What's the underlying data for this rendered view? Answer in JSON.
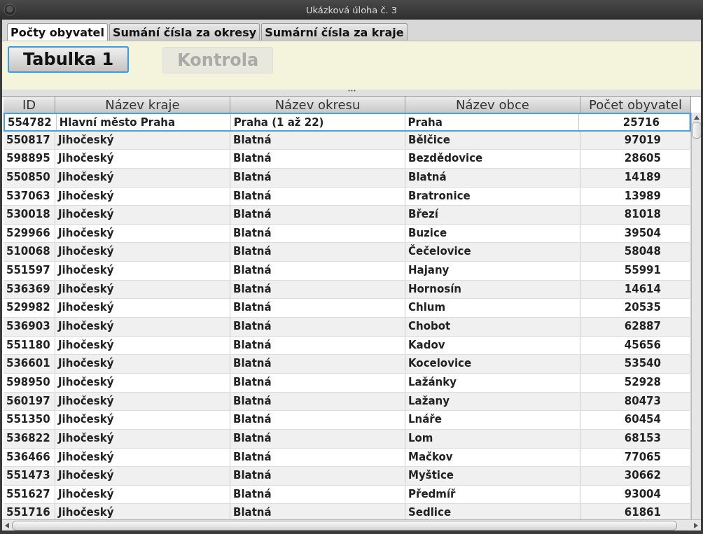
{
  "window": {
    "title": "Ukázková úloha č. 3"
  },
  "tabs": [
    {
      "label": "Počty obyvatel",
      "selected": true
    },
    {
      "label": "Sumání čísla za okresy",
      "selected": false
    },
    {
      "label": "Sumární čísla za kraje",
      "selected": false
    }
  ],
  "buttons": [
    {
      "label": "Tabulka 1",
      "disabled": false,
      "focused": true
    },
    {
      "label": "Kontrola",
      "disabled": true,
      "focused": false
    }
  ],
  "table": {
    "columns": [
      "ID",
      "Název kraje",
      "Název okresu",
      "Název obce",
      "Počet obyvatel"
    ],
    "rows": [
      {
        "cells": [
          "554782",
          "Hlavní město Praha",
          "Praha (1 až 22)",
          "Praha",
          "25716"
        ],
        "selected": true
      },
      {
        "cells": [
          "550817",
          "Jihočeský",
          "Blatná",
          "Bělčice",
          "97019"
        ],
        "selected": false
      },
      {
        "cells": [
          "598895",
          "Jihočeský",
          "Blatná",
          "Bezdědovice",
          "28605"
        ],
        "selected": false
      },
      {
        "cells": [
          "550850",
          "Jihočeský",
          "Blatná",
          "Blatná",
          "14189"
        ],
        "selected": false
      },
      {
        "cells": [
          "537063",
          "Jihočeský",
          "Blatná",
          "Bratronice",
          "13989"
        ],
        "selected": false
      },
      {
        "cells": [
          "530018",
          "Jihočeský",
          "Blatná",
          "Březí",
          "81018"
        ],
        "selected": false
      },
      {
        "cells": [
          "529966",
          "Jihočeský",
          "Blatná",
          "Buzice",
          "39504"
        ],
        "selected": false
      },
      {
        "cells": [
          "510068",
          "Jihočeský",
          "Blatná",
          "Čečelovice",
          "58048"
        ],
        "selected": false
      },
      {
        "cells": [
          "551597",
          "Jihočeský",
          "Blatná",
          "Hajany",
          "55991"
        ],
        "selected": false
      },
      {
        "cells": [
          "536369",
          "Jihočeský",
          "Blatná",
          "Hornosín",
          "14614"
        ],
        "selected": false
      },
      {
        "cells": [
          "529982",
          "Jihočeský",
          "Blatná",
          "Chlum",
          "20535"
        ],
        "selected": false
      },
      {
        "cells": [
          "536903",
          "Jihočeský",
          "Blatná",
          "Chobot",
          "62887"
        ],
        "selected": false
      },
      {
        "cells": [
          "551180",
          "Jihočeský",
          "Blatná",
          "Kadov",
          "45656"
        ],
        "selected": false
      },
      {
        "cells": [
          "536601",
          "Jihočeský",
          "Blatná",
          "Kocelovice",
          "53540"
        ],
        "selected": false
      },
      {
        "cells": [
          "598950",
          "Jihočeský",
          "Blatná",
          "Lažánky",
          "52928"
        ],
        "selected": false
      },
      {
        "cells": [
          "560197",
          "Jihočeský",
          "Blatná",
          "Lažany",
          "80473"
        ],
        "selected": false
      },
      {
        "cells": [
          "551350",
          "Jihočeský",
          "Blatná",
          "Lnáře",
          "60454"
        ],
        "selected": false
      },
      {
        "cells": [
          "536822",
          "Jihočeský",
          "Blatná",
          "Lom",
          "68153"
        ],
        "selected": false
      },
      {
        "cells": [
          "536466",
          "Jihočeský",
          "Blatná",
          "Mačkov",
          "77065"
        ],
        "selected": false
      },
      {
        "cells": [
          "551473",
          "Jihočeský",
          "Blatná",
          "Myštice",
          "30662"
        ],
        "selected": false
      },
      {
        "cells": [
          "551627",
          "Jihočeský",
          "Blatná",
          "Předmíř",
          "93004"
        ],
        "selected": false
      },
      {
        "cells": [
          "551716",
          "Jihočeský",
          "Blatná",
          "Sedlice",
          "61861"
        ],
        "selected": false
      }
    ]
  }
}
